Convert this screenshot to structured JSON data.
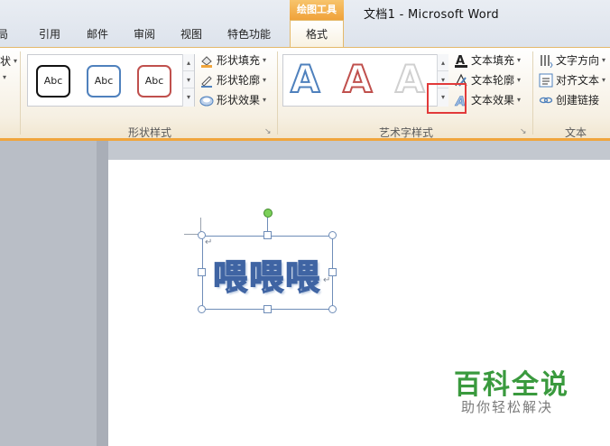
{
  "title_bar": {
    "window_title": "文档1  -  Microsoft Word",
    "context_tab_label": "绘图工具"
  },
  "tabs": [
    {
      "label": "局"
    },
    {
      "label": "引用"
    },
    {
      "label": "邮件"
    },
    {
      "label": "审阅"
    },
    {
      "label": "视图"
    },
    {
      "label": "特色功能"
    },
    {
      "label": "格式",
      "active": true
    }
  ],
  "ribbon": {
    "left_stub": {
      "row1": "状",
      "row2": ""
    },
    "shape_styles": {
      "group_label": "形状样式",
      "gallery": [
        {
          "label": "Abc",
          "border_color": "#111111"
        },
        {
          "label": "Abc",
          "border_color": "#4f81bd"
        },
        {
          "label": "Abc",
          "border_color": "#c0504d"
        }
      ],
      "commands": [
        {
          "label": "形状填充",
          "icon": "paint-bucket-icon"
        },
        {
          "label": "形状轮廓",
          "icon": "pen-outline-icon"
        },
        {
          "label": "形状效果",
          "icon": "shape-effect-icon"
        }
      ]
    },
    "wordart_styles": {
      "group_label": "艺术字样式",
      "gallery": [
        {
          "glyph": "A",
          "fill": "#ffffff",
          "stroke": "#4f81bd"
        },
        {
          "glyph": "A",
          "fill": "#ffffff",
          "stroke": "#c0504d"
        },
        {
          "glyph": "A",
          "fill": "#ffffff",
          "stroke": "#d0d0d0"
        }
      ],
      "commands": [
        {
          "label": "文本填充",
          "icon": "text-fill-icon"
        },
        {
          "label": "文本轮廓",
          "icon": "text-outline-icon"
        },
        {
          "label": "文本效果",
          "icon": "text-effect-icon"
        }
      ]
    },
    "text_group": {
      "group_label": "文本",
      "commands": [
        {
          "label": "文字方向",
          "icon": "text-direction-icon"
        },
        {
          "label": "对齐文本",
          "icon": "align-text-icon"
        },
        {
          "label": "创建链接",
          "icon": "link-icon"
        }
      ]
    }
  },
  "document": {
    "wordart_text": "喂喂喂"
  },
  "watermark": {
    "title": "百科全说",
    "subtitle": "助你轻松解决"
  },
  "colors": {
    "accent_orange": "#f0a53c",
    "highlight_red": "#e23a3a",
    "wordart_stroke": "#3f64a3",
    "watermark_green": "#3a9a3e"
  }
}
